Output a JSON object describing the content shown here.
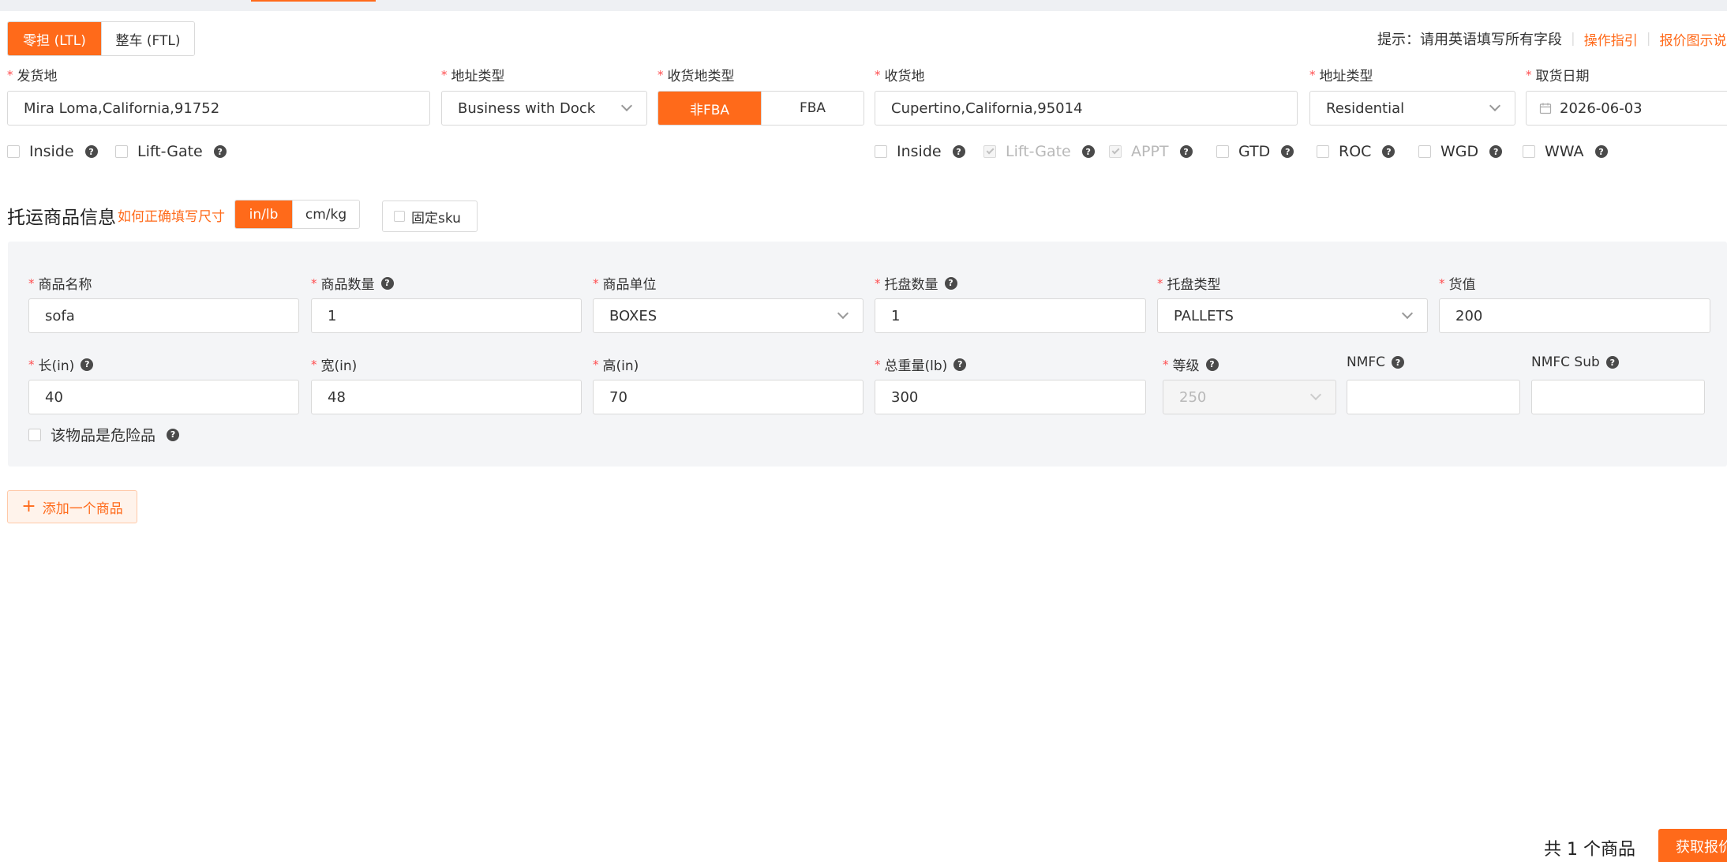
{
  "mode_tabs": [
    {
      "label": "零担 (LTL)",
      "active": true
    },
    {
      "label": "整车 (FTL)",
      "active": false
    }
  ],
  "hint": {
    "text": "提示：请用英语填写所有字段",
    "guide_link": "操作指引",
    "diagram_link": "报价图示说明"
  },
  "origin": {
    "label": "发货地",
    "value": "Mira Loma,California,91752",
    "address_type_label": "地址类型",
    "address_type_value": "Business with Dock",
    "options": [
      {
        "label": "Inside",
        "checked": false,
        "disabled": false
      },
      {
        "label": "Lift-Gate",
        "checked": false,
        "disabled": false
      }
    ]
  },
  "receiver_type": {
    "label": "收货地类型",
    "options": [
      {
        "label": "非FBA",
        "active": true
      },
      {
        "label": "FBA",
        "active": false
      }
    ]
  },
  "destination": {
    "label": "收货地",
    "value": "Cupertino,California,95014",
    "address_type_label": "地址类型",
    "address_type_value": "Residential",
    "options": [
      {
        "label": "Inside",
        "checked": false,
        "disabled": false
      },
      {
        "label": "Lift-Gate",
        "checked": true,
        "disabled": true
      },
      {
        "label": "APPT",
        "checked": true,
        "disabled": true
      },
      {
        "label": "GTD",
        "checked": false,
        "disabled": false
      },
      {
        "label": "ROC",
        "checked": false,
        "disabled": false
      },
      {
        "label": "WGD",
        "checked": false,
        "disabled": false
      },
      {
        "label": "WWA",
        "checked": false,
        "disabled": false
      }
    ]
  },
  "pickup_date": {
    "label": "取货日期",
    "value": "2026-06-03"
  },
  "goods_section": {
    "title": "托运商品信息",
    "help_link": "如何正确填写尺寸",
    "unit_tabs": [
      {
        "label": "in/lb",
        "active": true
      },
      {
        "label": "cm/kg",
        "active": false
      }
    ],
    "fixed_sku_label": "固定sku"
  },
  "item": {
    "name": {
      "label": "商品名称",
      "value": "sofa"
    },
    "quantity": {
      "label": "商品数量",
      "value": "1"
    },
    "unit": {
      "label": "商品单位",
      "value": "BOXES"
    },
    "pallet_qty": {
      "label": "托盘数量",
      "value": "1"
    },
    "pallet_type": {
      "label": "托盘类型",
      "value": "PALLETS"
    },
    "goods_value": {
      "label": "货值",
      "value": "200"
    },
    "length": {
      "label": "长(in)",
      "value": "40"
    },
    "width": {
      "label": "宽(in)",
      "value": "48"
    },
    "height": {
      "label": "高(in)",
      "value": "70"
    },
    "weight": {
      "label": "总重量(lb)",
      "value": "300"
    },
    "class": {
      "label": "等级",
      "value": "250"
    },
    "nmfc": {
      "label": "NMFC",
      "value": ""
    },
    "nmfc_sub": {
      "label": "NMFC Sub",
      "value": ""
    },
    "hazmat_label": "该物品是危险品"
  },
  "add_item_label": "添加一个商品",
  "footer": {
    "total_text": "共 1 个商品",
    "quote_button": "获取报价"
  },
  "colors": {
    "accent": "#ff6a1a",
    "required": "#ff4d4f",
    "panel_bg": "#f4f5f7"
  }
}
